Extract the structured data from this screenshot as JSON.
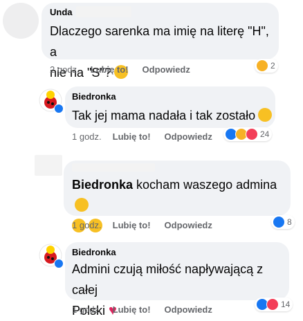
{
  "comments": [
    {
      "author": "Unda",
      "text_lines": [
        "Dlaczego sarenka ma imię na literę \"H\", a",
        "nie na \"S\"?"
      ],
      "time": "2 godz.",
      "like_label": "Lubię to!",
      "reply_label": "Odpowiedz",
      "reactions": [
        "haha"
      ],
      "reaction_count": "2"
    },
    {
      "author": "Biedronka",
      "text_lines": [
        "Tak jej mama nadała i tak zostało"
      ],
      "time": "1 godz.",
      "like_label": "Lubię to!",
      "reply_label": "Odpowiedz",
      "reactions": [
        "like",
        "haha",
        "love"
      ],
      "reaction_count": "24"
    },
    {
      "author": "Biedronka",
      "text_lines": [
        "kocham waszego admina"
      ],
      "time": "1 godz.",
      "like_label": "Lubię to!",
      "reply_label": "Odpowiedz",
      "reactions": [
        "like"
      ],
      "reaction_count": "8"
    },
    {
      "author": "Biedronka",
      "text_lines": [
        "Admini czują miłość napływającą z całej",
        "Polski"
      ],
      "time": "1 godz.",
      "like_label": "Lubię to!",
      "reply_label": "Odpowiedz",
      "reactions": [
        "like",
        "love"
      ],
      "reaction_count": "14"
    }
  ],
  "icons": {
    "avatar_brand": "ladybug-logo",
    "verified": "verified-badge-icon",
    "emoji_wink": "winking-face-icon",
    "emoji_smile": "smiling-face-icon",
    "emoji_laugh": "tears-of-joy-icon",
    "heart": "red-heart-icon"
  },
  "colors": {
    "bubble": "#f0f2f5",
    "meta_text": "#65676b",
    "like": "#1877f2",
    "love": "#f33e58",
    "haha": "#f7b125"
  }
}
